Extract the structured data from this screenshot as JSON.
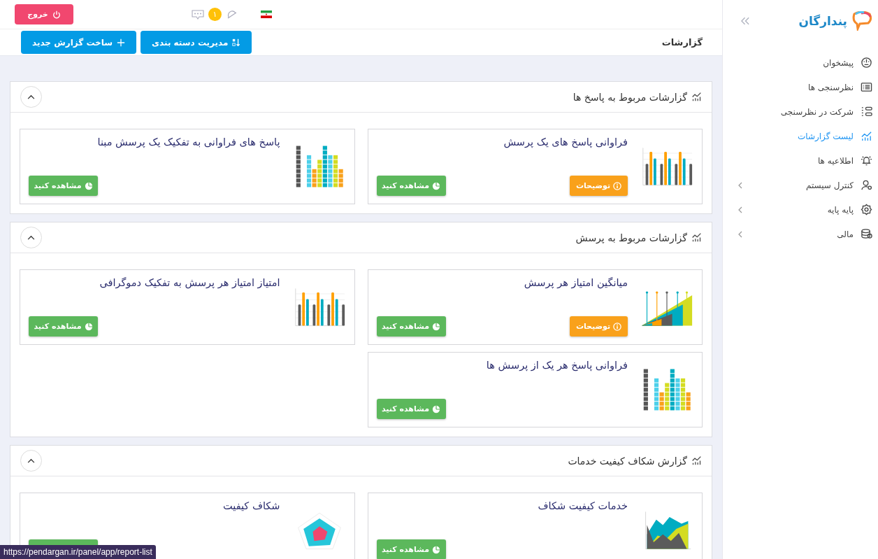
{
  "sidebar": {
    "logo": "پندارگان",
    "items": [
      {
        "label": "پیشخوان",
        "selected": false,
        "has_submenu": false
      },
      {
        "label": "نظرسنجی ها",
        "selected": false,
        "has_submenu": false
      },
      {
        "label": "شرکت در نظرسنجی",
        "selected": false,
        "has_submenu": false
      },
      {
        "label": "لیست گزارشات",
        "selected": true,
        "has_submenu": false
      },
      {
        "label": "اطلاعیه ها",
        "selected": false,
        "has_submenu": false
      },
      {
        "label": "کنترل سیستم",
        "selected": false,
        "has_submenu": true
      },
      {
        "label": "پایه پایه",
        "selected": false,
        "has_submenu": true
      },
      {
        "label": "مالی",
        "selected": false,
        "has_submenu": true
      }
    ]
  },
  "topbar": {
    "badge": "۱",
    "logout": "خروج"
  },
  "header": {
    "title": "گزارشات",
    "buttons": [
      {
        "label": "مدیریت دسته بندی"
      },
      {
        "label": "ساخت گزارش جدید"
      }
    ]
  },
  "sections": [
    {
      "title": "گزارشات مربوط به پاسخ ها",
      "expanded": true,
      "columns": [
        [
          {
            "title": "فراوانی پاسخ های یک پرسش",
            "kind": "bars",
            "details": "توضیحات",
            "view_button": {
              "label": "مشاهده کنید"
            }
          }
        ],
        [
          {
            "title": "پاسخ های فراوانی به تفکیک یک پرسش مبنا",
            "kind": "blocks",
            "view_button": {
              "label": "مشاهده کنید"
            }
          }
        ]
      ]
    },
    {
      "title": "گزارشات مربوط به پرسش",
      "expanded": true,
      "columns": [
        [
          {
            "title": "میانگین امتیاز هر پرسش",
            "kind": "funnel",
            "details": "توضیحات",
            "view_button": {
              "label": "مشاهده کنید"
            }
          },
          {
            "title": "فراوانی پاسخ هر یک از پرسش ها",
            "kind": "blocks",
            "view_button": {
              "label": "مشاهده کنید"
            }
          }
        ],
        [
          {
            "title": "امتیاز امتیاز هر پرسش به تفکیک دموگرافی",
            "kind": "bars",
            "view_button": {
              "label": "مشاهده کنید"
            }
          }
        ]
      ]
    },
    {
      "title": "گزارش شکاف کیفیت خدمات",
      "expanded": true,
      "columns": [
        [
          {
            "title": "خدمات کیفیت شکاف",
            "kind": "area",
            "view_button": {
              "label": "مشاهده کنید"
            }
          }
        ],
        [
          {
            "title": "شکاف کیفیت",
            "kind": "radar",
            "view_covered": true
          }
        ]
      ]
    }
  ],
  "status_url": "https://pendargan.ir/panel/app/report-list"
}
